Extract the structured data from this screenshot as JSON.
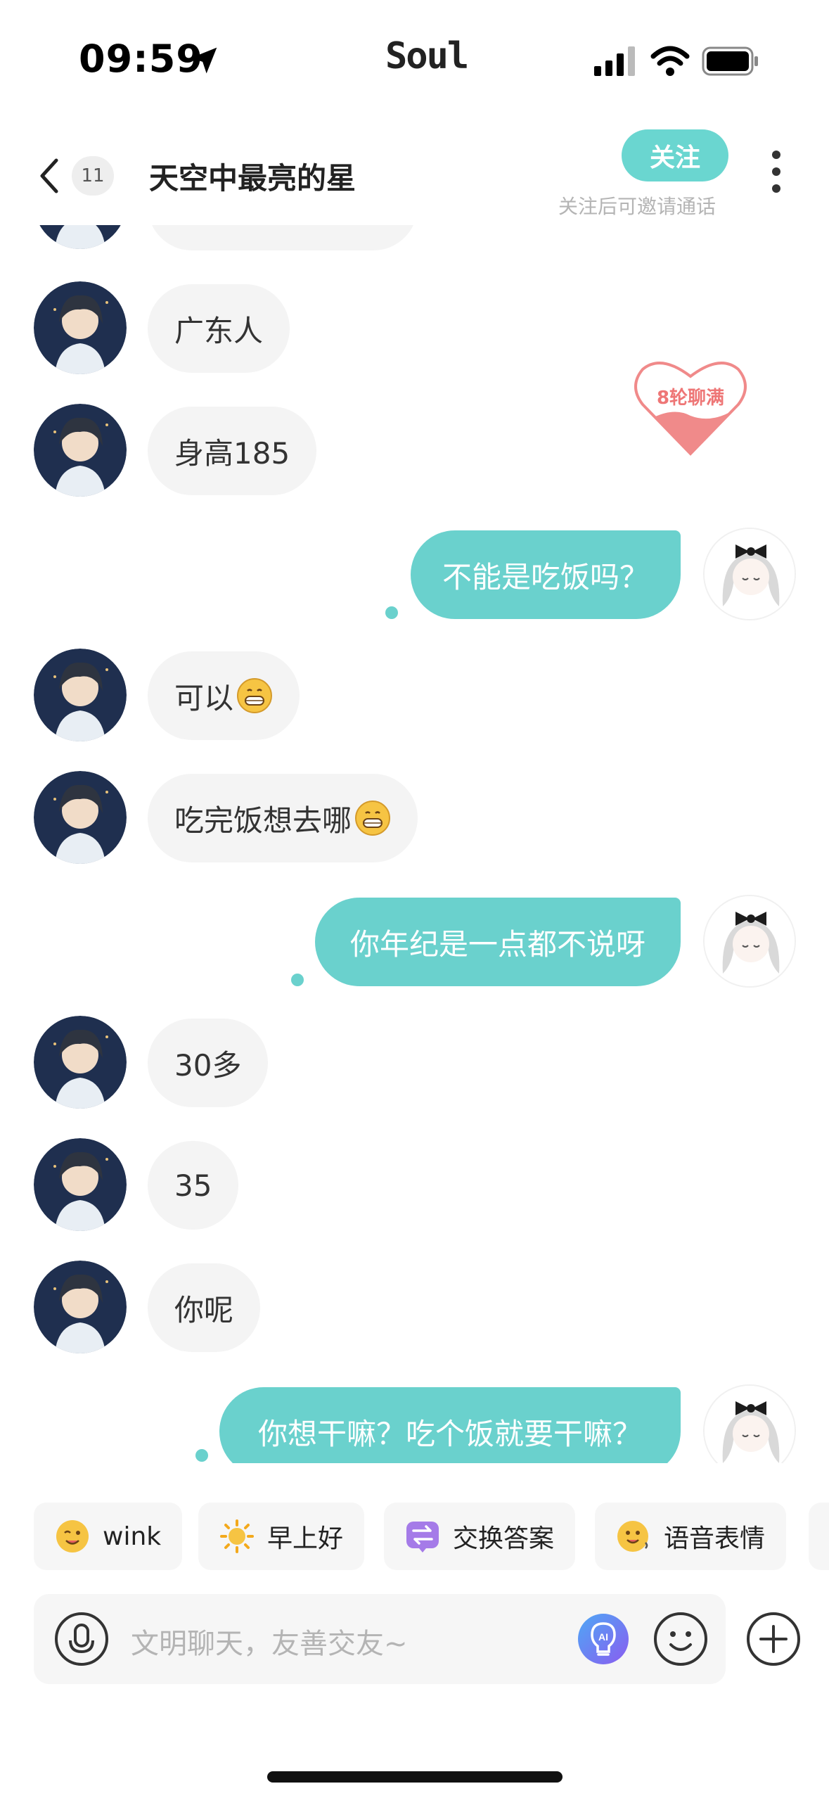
{
  "status_bar": {
    "time": "09:59",
    "brand": "Soul"
  },
  "header": {
    "unread_count": "11",
    "title": "天空中最亮的星",
    "follow_label": "关注",
    "follow_hint": "关注后可邀请通话"
  },
  "heart_badge": "8轮聊满",
  "messages": [
    {
      "side": "in",
      "text": "广东人"
    },
    {
      "side": "in",
      "text": "身高185"
    },
    {
      "side": "out",
      "text": "不能是吃饭吗？"
    },
    {
      "side": "in",
      "text": "可以",
      "emoji": "grin"
    },
    {
      "side": "in",
      "text": "吃完饭想去哪",
      "emoji": "grin"
    },
    {
      "side": "out",
      "text": "你年纪是一点都不说呀"
    },
    {
      "side": "in",
      "text": "30多"
    },
    {
      "side": "in",
      "text": "35"
    },
    {
      "side": "in",
      "text": "你呢"
    },
    {
      "side": "out",
      "text": "你想干嘛？吃个饭就要干嘛？"
    }
  ],
  "quick_replies": [
    {
      "icon": "wink-emoji-icon",
      "label": "wink"
    },
    {
      "icon": "sun-icon",
      "label": "早上好"
    },
    {
      "icon": "swap-icon",
      "label": "交换答案"
    },
    {
      "icon": "voice-emoji-icon",
      "label": "语音表情"
    }
  ],
  "input": {
    "placeholder": "文明聊天，友善交友~"
  },
  "colors": {
    "accent": "#6ad1cd",
    "bubble_in": "#f4f4f4",
    "heart": "#f08080"
  }
}
